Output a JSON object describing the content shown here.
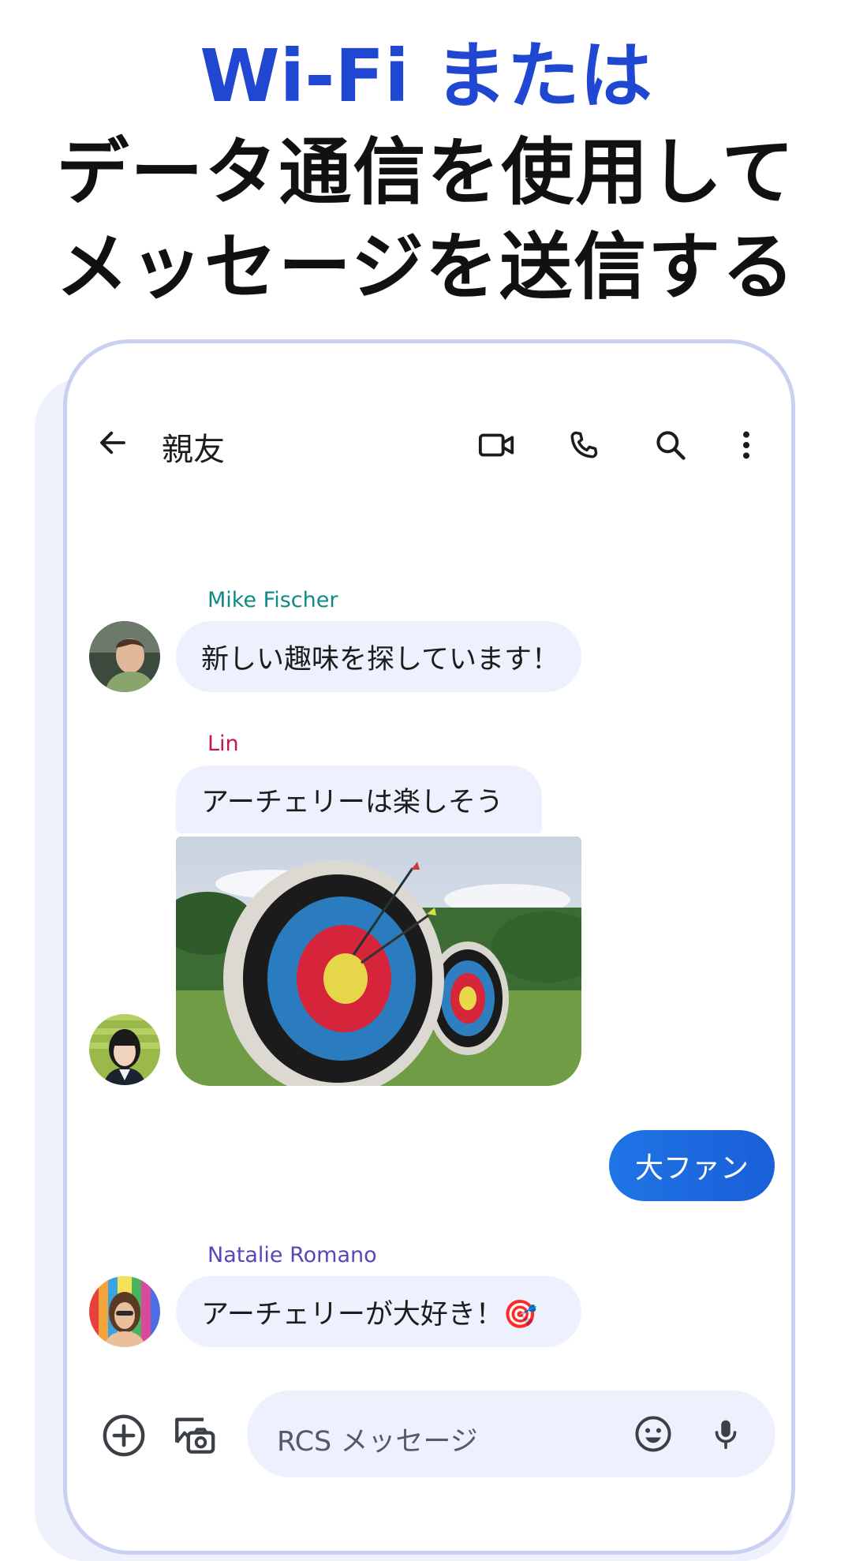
{
  "headline": {
    "line1": "Wi-Fi または",
    "line2": "データ通信を使用して",
    "line3": "メッセージを送信する"
  },
  "colors": {
    "headline_accent": "#1f47d1",
    "outgoing_bubble": "#1a6be0",
    "incoming_bubble": "#edf1fd",
    "mike_name": "#0f8a87",
    "lin_name": "#c2185b",
    "natalie_name": "#5a46b8"
  },
  "toolbar": {
    "title": "親友",
    "icons": [
      "back-arrow-icon",
      "video-call-icon",
      "phone-icon",
      "search-icon",
      "more-vert-icon"
    ]
  },
  "messages": [
    {
      "sender": "Mike Fischer",
      "text": "新しい趣味を探しています！"
    },
    {
      "sender": "Lin",
      "text": "アーチェリーは楽しそう",
      "attachment": "archery-target-photo"
    },
    {
      "sender": "me",
      "text": "大ファン"
    },
    {
      "sender": "Natalie Romano",
      "text": "アーチェリーが大好き！🎯"
    }
  ],
  "composer": {
    "placeholder": "RCS メッセージ",
    "icons": [
      "add-icon",
      "gallery-icon",
      "emoji-icon",
      "mic-icon"
    ]
  }
}
